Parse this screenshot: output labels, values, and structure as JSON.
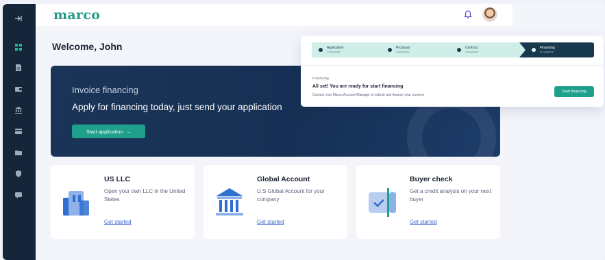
{
  "app": {
    "brand": "marco",
    "brand_color": "#1f9b86"
  },
  "sidebar": {
    "collapse_icon": "collapse-icon",
    "items": [
      {
        "icon": "dashboard-icon",
        "active": true
      },
      {
        "icon": "document-icon",
        "active": false
      },
      {
        "icon": "wallet-icon",
        "active": false
      },
      {
        "icon": "bank-icon",
        "active": false
      },
      {
        "icon": "card-icon",
        "active": false
      },
      {
        "icon": "folder-icon",
        "active": false
      },
      {
        "icon": "shield-icon",
        "active": false
      },
      {
        "icon": "chat-icon",
        "active": false
      }
    ]
  },
  "header": {
    "notification_icon": "bell-icon",
    "avatar": "user-avatar"
  },
  "main": {
    "welcome": "Welcome, John",
    "hero": {
      "subtitle": "Invoice financing",
      "title": "Apply for financing today, just send your application",
      "button_label": "Start application",
      "button_arrow": "→"
    },
    "cards": [
      {
        "title": "US LLC",
        "description": "Open your own LLC in the United States",
        "link": "Get started",
        "icon": "building-icon"
      },
      {
        "title": "Global Account",
        "description": "U.S Global Account for your company",
        "link": "Get started",
        "icon": "bank-icon"
      },
      {
        "title": "Buyer check",
        "description": "Get a credit analysis on your next buyer",
        "link": "Get started",
        "icon": "check-document-icon"
      }
    ]
  },
  "progress_panel": {
    "steps": [
      {
        "name": "Application",
        "state": "Completed"
      },
      {
        "name": "Proposal",
        "state": "Completed"
      },
      {
        "name": "Contract",
        "state": "Completed"
      },
      {
        "name": "Financing",
        "state": "In progress"
      }
    ],
    "label": "Financing",
    "title": "All set! You are ready for start financing",
    "description": "Contact your Marco Account Manager to submit and finance your invoices",
    "button_label": "Start financing"
  },
  "colors": {
    "sidebar_bg": "#16263a",
    "accent": "#1fa08c",
    "hero_bg": "#163055",
    "link": "#3b63d4"
  }
}
